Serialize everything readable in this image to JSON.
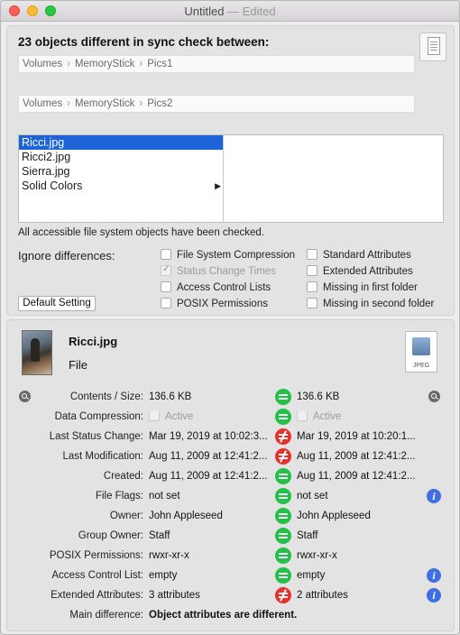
{
  "window": {
    "title": "Untitled",
    "edited_suffix": "— Edited"
  },
  "sync": {
    "heading": "23 objects different in sync check between:",
    "path1": [
      "Volumes",
      "MemoryStick",
      "Pics1"
    ],
    "path2": [
      "Volumes",
      "MemoryStick",
      "Pics2"
    ],
    "files": [
      {
        "name": "Ricci.jpg",
        "selected": true
      },
      {
        "name": "Ricci2.jpg"
      },
      {
        "name": "Sierra.jpg"
      },
      {
        "name": "Solid Colors",
        "has_submenu": true
      }
    ],
    "status_text": "All accessible file system objects have been checked.",
    "ignore_label": "Ignore differences:",
    "options": {
      "fs_compression": "File System Compression",
      "status_change": "Status Change Times",
      "acl": "Access Control Lists",
      "posix": "POSIX Permissions",
      "standard_attrs": "Standard Attributes",
      "extended_attrs": "Extended Attributes",
      "missing_first": "Missing in first folder",
      "missing_second": "Missing in second folder"
    },
    "default_button": "Default Setting"
  },
  "detail": {
    "name": "Ricci.jpg",
    "kind": "File",
    "file_icon_label": "JPEG",
    "rows": [
      {
        "label": "Contents / Size:",
        "left": "136.6 KB",
        "right": "136.6 KB",
        "status": "equal"
      },
      {
        "label": "Data Compression:",
        "left": "Active",
        "right": "Active",
        "status": "equal"
      },
      {
        "label": "Last Status Change:",
        "left": "Mar 19, 2019 at 10:02:3...",
        "right": "Mar 19, 2019 at 10:20:1...",
        "status": "different"
      },
      {
        "label": "Last Modification:",
        "left": "Aug 11, 2009 at 12:41:2...",
        "right": "Aug 11, 2009 at 12:41:2...",
        "status": "equal"
      },
      {
        "label": "Created:",
        "left": "Aug 11, 2009 at 12:41:2...",
        "right": "Aug 11, 2009 at 12:41:2...",
        "status": "equal"
      },
      {
        "label": "File Flags:",
        "left": "not set",
        "right": "not set",
        "status": "equal"
      },
      {
        "label": "Owner:",
        "left": "John Appleseed",
        "right": "John Appleseed",
        "status": "equal"
      },
      {
        "label": "Group Owner:",
        "left": "Staff",
        "right": "Staff",
        "status": "equal"
      },
      {
        "label": "POSIX Permissions:",
        "left": "rwxr-xr-x",
        "right": "rwxr-xr-x",
        "status": "equal"
      },
      {
        "label": "Access Control List:",
        "left": "empty",
        "right": "empty",
        "status": "equal"
      },
      {
        "label": "Extended Attributes:",
        "left": "3 attributes",
        "right": "2 attributes",
        "status": "different"
      }
    ],
    "main_diff_label": "Main difference:",
    "main_diff_value": "Object attributes are different."
  }
}
